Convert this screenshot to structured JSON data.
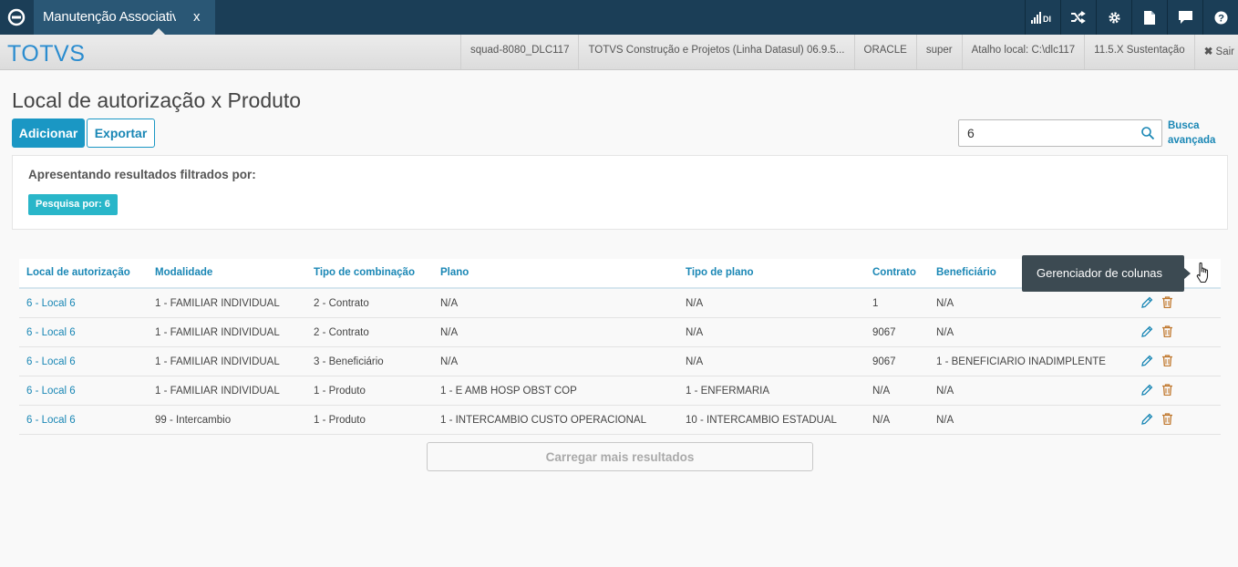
{
  "topbar": {
    "tab_label": "Manutenção Associativa",
    "tab_close": "x",
    "signal_label": "DI",
    "icons": [
      "signal-icon",
      "shuffle-icon",
      "gear-icon",
      "document-icon",
      "chat-icon",
      "help-icon"
    ]
  },
  "infobar": {
    "brand": "TOTVS",
    "items": [
      "squad-8080_DLC117",
      "TOTVS Construção e Projetos (Linha Datasul) 06.9.5...",
      "ORACLE",
      "super",
      "Atalho local: C:\\dlc117",
      "11.5.X Sustentação"
    ],
    "exit_label": "Sair"
  },
  "page": {
    "title": "Local de autorização x Produto",
    "add_label": "Adicionar",
    "export_label": "Exportar",
    "search_value": "6",
    "advanced_search_line1": "Busca",
    "advanced_search_line2": "avançada"
  },
  "filter": {
    "title": "Apresentando resultados filtrados por:",
    "tag": "Pesquisa por: 6"
  },
  "table": {
    "headers": [
      "Local de autorização",
      "Modalidade",
      "Tipo de combinação",
      "Plano",
      "Tipo de plano",
      "Contrato",
      "Beneficiário"
    ],
    "rows": [
      [
        "6 - Local 6",
        "1 - FAMILIAR INDIVIDUAL",
        "2 - Contrato",
        "N/A",
        "N/A",
        "1",
        "N/A"
      ],
      [
        "6 - Local 6",
        "1 - FAMILIAR INDIVIDUAL",
        "2 - Contrato",
        "N/A",
        "N/A",
        "9067",
        "N/A"
      ],
      [
        "6 - Local 6",
        "1 - FAMILIAR INDIVIDUAL",
        "3 - Beneficiário",
        "N/A",
        "N/A",
        "9067",
        "1 - BENEFICIARIO INADIMPLENTE"
      ],
      [
        "6 - Local 6",
        "1 - FAMILIAR INDIVIDUAL",
        "1 - Produto",
        "1 - E AMB HOSP OBST COP",
        "1 - ENFERMARIA",
        "N/A",
        "N/A"
      ],
      [
        "6 - Local 6",
        "99 - Intercambio",
        "1 - Produto",
        "1 - INTERCAMBIO CUSTO OPERACIONAL",
        "10 - INTERCAMBIO ESTADUAL",
        "N/A",
        "N/A"
      ]
    ],
    "tooltip": "Gerenciador de colunas",
    "load_more": "Carregar mais resultados"
  },
  "colors": {
    "topbar": "#1b3e57",
    "accent": "#1a97c4",
    "tag": "#29b6c9",
    "edit_icon": "#1a87b5",
    "delete_icon": "#c0782e"
  }
}
